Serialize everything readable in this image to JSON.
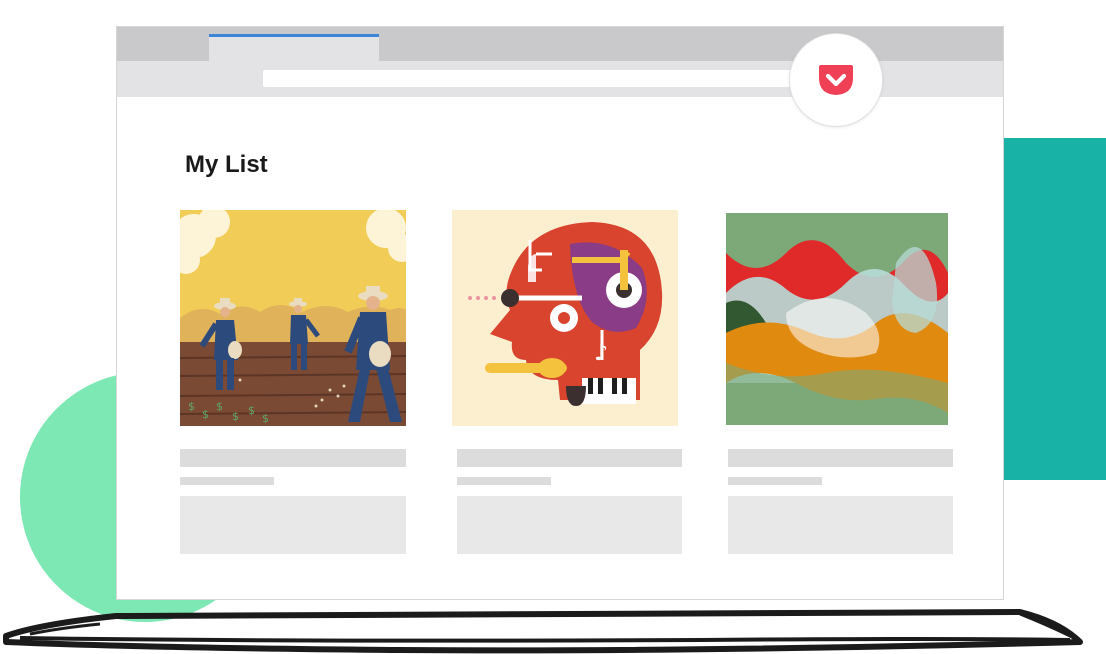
{
  "page": {
    "title": "My List"
  },
  "browser": {
    "address_bar": {
      "value": ""
    }
  },
  "colors": {
    "pocket_red": "#ef4056",
    "tab_accent": "#3d84d6",
    "deco_green": "#7ee8b4",
    "deco_teal": "#19b2a6"
  },
  "toolbar": {
    "save_icon": "pocket-icon"
  },
  "cards": [
    {
      "image": "sowers-field-illustration"
    },
    {
      "image": "music-head-illustration"
    },
    {
      "image": "abstract-waves-illustration"
    }
  ]
}
